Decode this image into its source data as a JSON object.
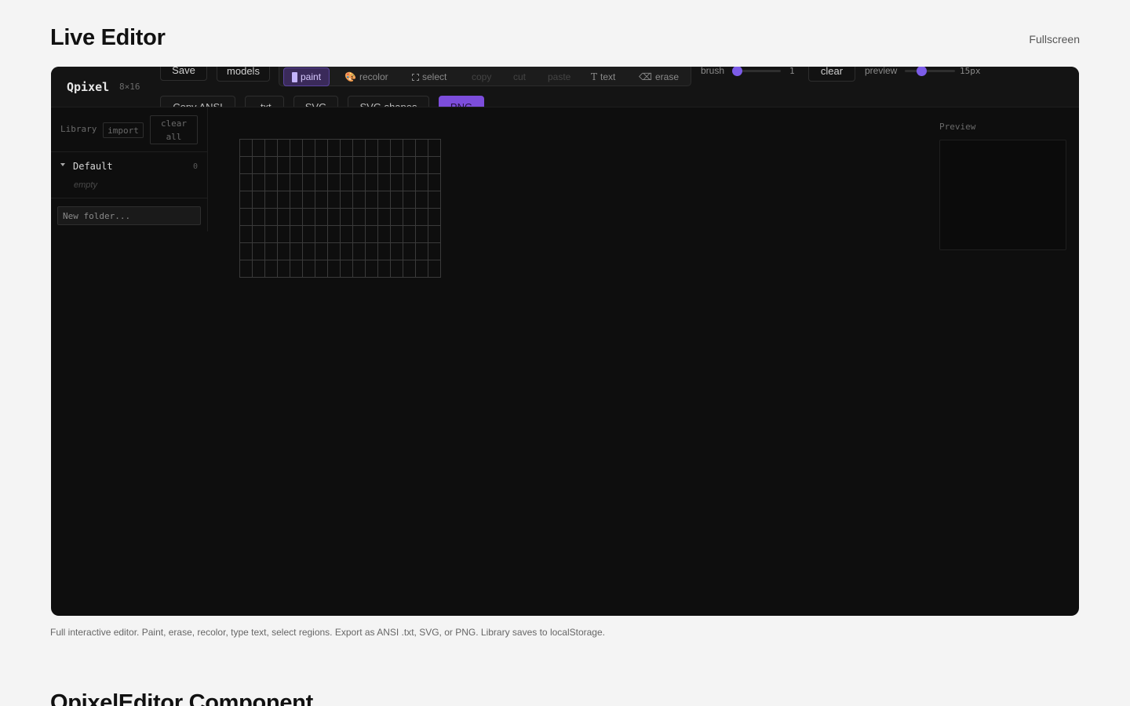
{
  "page": {
    "title": "Live Editor",
    "fullscreen_label": "Fullscreen",
    "caption": "Full interactive editor. Paint, erase, recolor, type text, select regions. Export as ANSI .txt, SVG, or PNG. Library saves to localStorage.",
    "next_section_title": "QpixelEditor Component"
  },
  "editor": {
    "brand": "Qpixel",
    "dimensions": "8×16",
    "save_label": "Save",
    "models_label": "models",
    "tools": [
      {
        "label": "paint",
        "icon": "paint-icon",
        "active": true
      },
      {
        "label": "recolor",
        "icon": "palette-icon",
        "emoji": "🎨"
      },
      {
        "label": "select",
        "icon": "select-icon"
      },
      {
        "label": "copy",
        "disabled": true
      },
      {
        "label": "cut",
        "disabled": true
      },
      {
        "label": "paste",
        "disabled": true
      },
      {
        "label": "text",
        "icon": "text-icon",
        "glyph": "T"
      },
      {
        "label": "erase",
        "icon": "erase-icon",
        "glyph": "⌫"
      }
    ],
    "brush": {
      "label": "brush",
      "value": "1",
      "level": 0.0
    },
    "clear_label": "clear",
    "preview_size": {
      "label": "preview",
      "value": "15px",
      "level": 0.3
    },
    "exports": [
      {
        "label": "Copy ANSI"
      },
      {
        "label": ".txt"
      },
      {
        "label": "SVG"
      },
      {
        "label": "SVG shapes"
      },
      {
        "label": "PNG",
        "primary": true
      }
    ],
    "accent_color": "#7c4ddb"
  },
  "library": {
    "label": "Library",
    "import_label": "import",
    "clear_all_label": "clear all",
    "folders": [
      {
        "name": "Default",
        "count": "0",
        "empty_text": "empty",
        "expanded": true
      }
    ],
    "new_folder_placeholder": "New folder..."
  },
  "canvas": {
    "rows": 8,
    "cols": 16
  },
  "preview": {
    "label": "Preview"
  }
}
